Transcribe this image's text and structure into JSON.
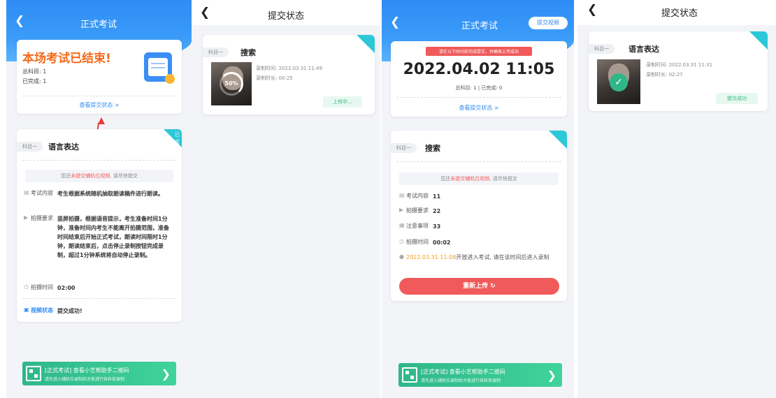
{
  "panel1": {
    "title": "正式考试",
    "banner": {
      "heading": "本场考试已结束!",
      "total": "总科目: 1",
      "done": "已完成: 1",
      "link": "查看提交状态 >"
    },
    "subject": {
      "tag": "科目一",
      "name": "语言表达",
      "corner": "已交",
      "notice_pre": "您还",
      "notice_red": "未提交辅机位视频",
      "notice_post": ", 请尽快提交",
      "rows": [
        {
          "label": "考试内容",
          "value": "考生根据系统随机抽取朗读稿件进行朗读。"
        },
        {
          "label": "拍摄要求",
          "value": "竖屏拍摄，根据语音提示，考生准备时间1分钟，准备时间内考生不能离开拍摄范围，准备时间结束后开始正式考试，朗读时间限时1分钟，朗读结束后，点击停止录制按钮完成录制，超过1分钟系统将自动停止录制。"
        },
        {
          "label": "拍摄时间",
          "value": "02:00"
        }
      ],
      "video_label": "视频状态",
      "video_value": "提交成功!"
    },
    "qr": {
      "line1": "[正式考试] 查看小艺帮助手二维码",
      "line2": "请先进入辅机位录制后才能进行各科目录制"
    }
  },
  "panel2": {
    "title": "提交状态",
    "tag": "科目一",
    "name": "搜索",
    "rec_time": "录制时间: 2022.03.31 11:49",
    "rec_len": "录制时长: 00:25",
    "progress": "50%",
    "status": "上传中..."
  },
  "panel3": {
    "title": "正式考试",
    "submit_video": "提交视频",
    "warn": "请在以下时间前完成提交，并确保上传成功",
    "deadline": "2022.04.02 11:05",
    "counts": "总科目: 1 | 已完成: 0",
    "link": "查看提交状态 >",
    "tag": "科目一",
    "name": "搜索",
    "notice_pre": "您还",
    "notice_red": "未提交辅机位视频",
    "notice_post": ", 请尽快提交",
    "rows": [
      {
        "label": "考试内容",
        "value": "11"
      },
      {
        "label": "拍摄要求",
        "value": "22"
      },
      {
        "label": "注意事项",
        "value": "33"
      },
      {
        "label": "拍摄时间",
        "value": "00:02"
      }
    ],
    "open_time": "2022.03.31 11:08",
    "open_text": "开放进入考试, 请在该时间后进入录制",
    "reupload": "重新上传 ↻",
    "qr": {
      "line1": "[正式考试] 查看小艺帮助手二维码",
      "line2": "请先进入辅机位录制后才能进行各科目录制"
    }
  },
  "panel4": {
    "title": "提交状态",
    "tag": "科目一",
    "name": "语言表达",
    "rec_time": "录制时间: 2022.03.31 11:31",
    "rec_len": "录制时长: 02:27",
    "status": "提交成功"
  }
}
